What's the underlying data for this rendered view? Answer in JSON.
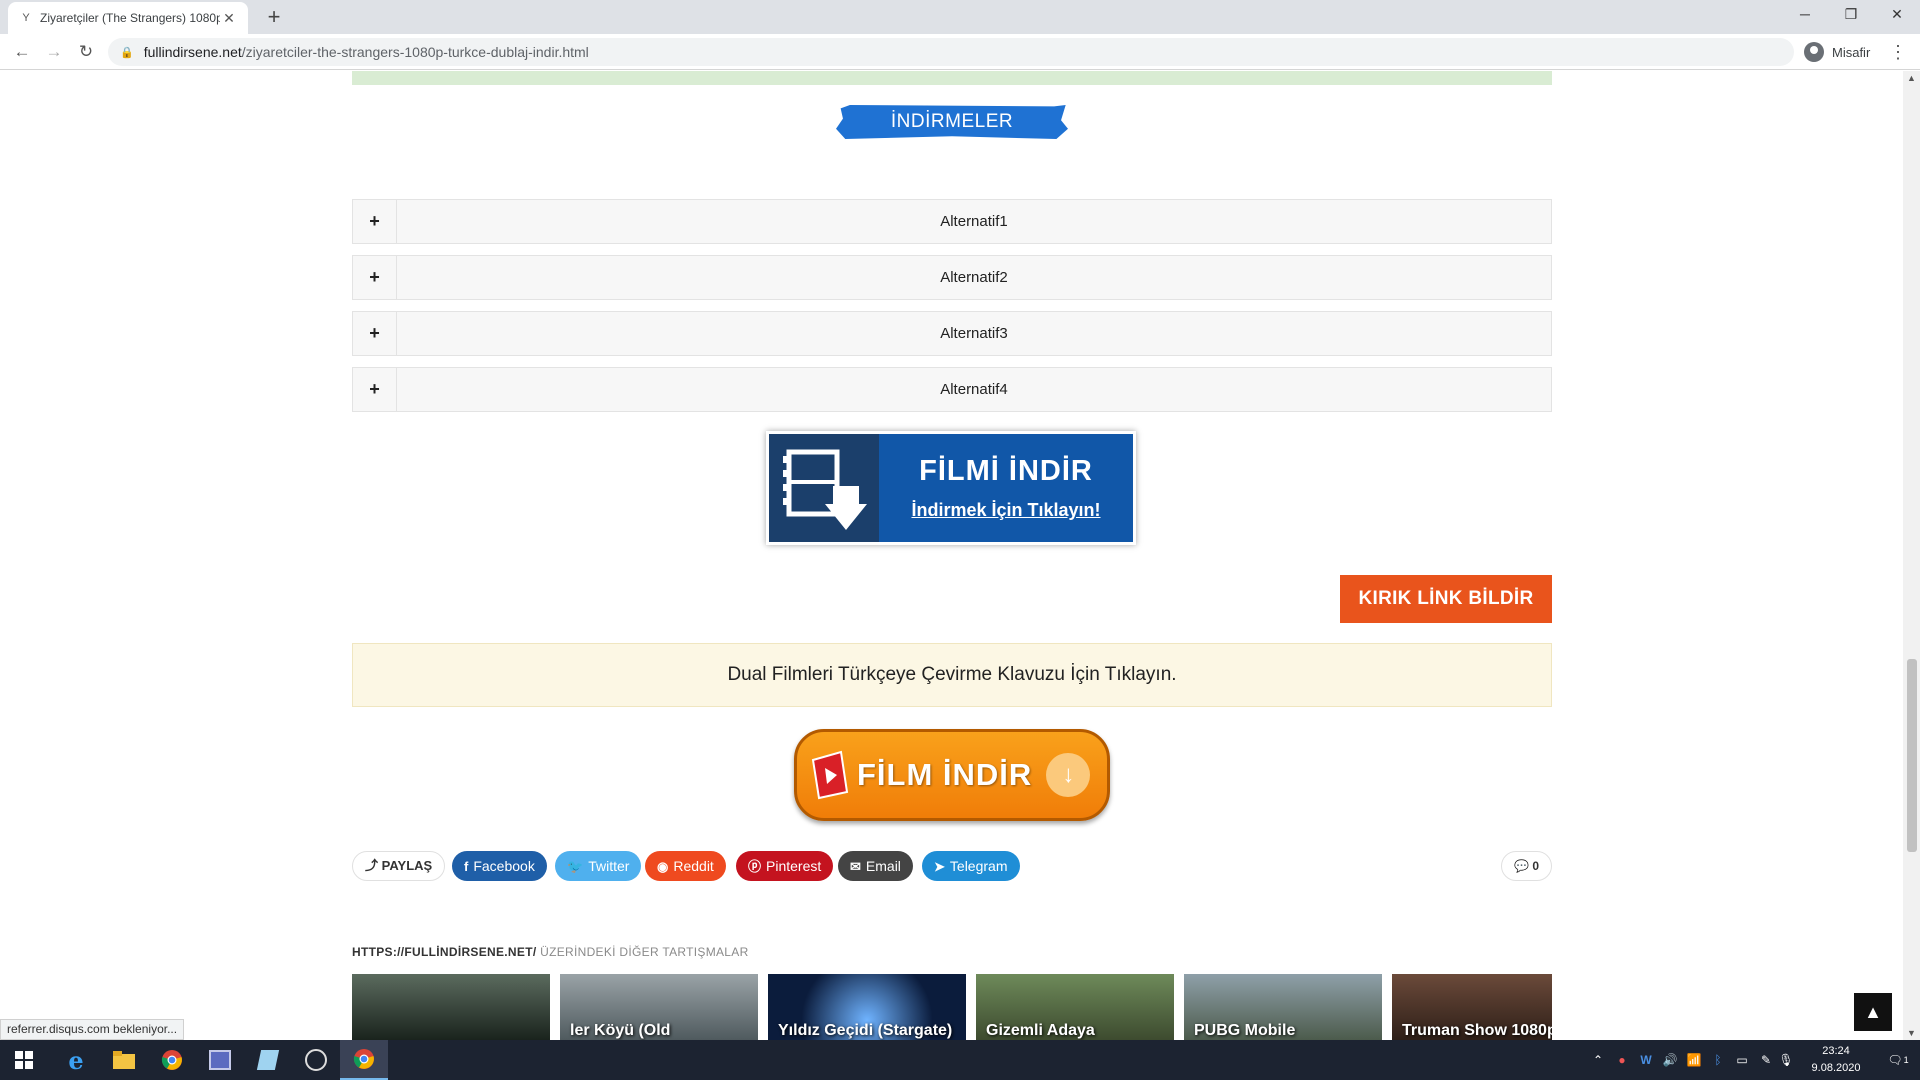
{
  "browser": {
    "tab_title": "Ziyaretçiler (The Strangers) 1080p",
    "tab_favicon": "Y",
    "url_host": "fullindirsene.net",
    "url_path": "/ziyaretciler-the-strangers-1080p-turkce-dublaj-indir.html",
    "profile_name": "Misafir",
    "status_text": "referrer.disqus.com bekleniyor..."
  },
  "page": {
    "section_title": "İNDİRMELER",
    "alternatives": [
      {
        "label": "Alternatif1"
      },
      {
        "label": "Alternatif2"
      },
      {
        "label": "Alternatif3"
      },
      {
        "label": "Alternatif4"
      }
    ],
    "download_banner": {
      "title": "FİLMİ İNDİR",
      "subtitle": "İndirmek İçin Tıklayın!"
    },
    "broken_link_button": "KIRIK LİNK BİLDİR",
    "guide_text": "Dual Filmleri Türkçeye Çevirme Klavuzu İçin Tıklayın.",
    "film_indir_button": "FİLM İNDİR",
    "share": {
      "label": "PAYLAŞ",
      "buttons": [
        {
          "label": "Facebook",
          "color": "#1f5fa8"
        },
        {
          "label": "Twitter",
          "color": "#4fb0ee"
        },
        {
          "label": "Reddit",
          "color": "#ef4a1f"
        },
        {
          "label": "Pinterest",
          "color": "#c4131f"
        },
        {
          "label": "Email",
          "color": "#444444"
        },
        {
          "label": "Telegram",
          "color": "#1f8ed6"
        }
      ],
      "comment_count": "0"
    },
    "disqus": {
      "site": "HTTPS://FULLİNDİRSENE.NET/",
      "heading": "ÜZERİNDEKİ DİĞER TARTIŞMALAR",
      "threads": [
        {
          "caption": ""
        },
        {
          "caption": "ler Köyü (Old"
        },
        {
          "caption": "Yıldız Geçidi (Stargate)"
        },
        {
          "caption": "Gizemli Adaya"
        },
        {
          "caption": "PUBG Mobile"
        },
        {
          "caption": "Truman Show 1080p"
        }
      ]
    }
  },
  "taskbar": {
    "time": "23:24",
    "date": "9.08.2020",
    "notification_count": "1"
  }
}
